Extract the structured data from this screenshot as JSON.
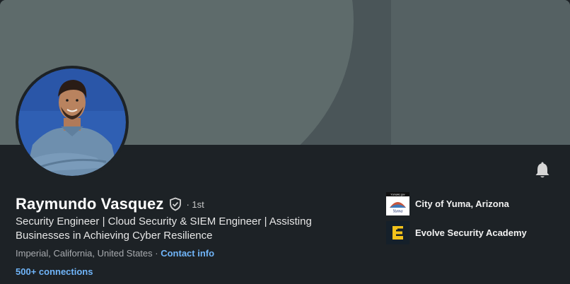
{
  "profile": {
    "name": "Raymundo Vasquez",
    "degree": "· 1st",
    "headline": "Security Engineer | Cloud Security & SIEM Engineer | Assisting Businesses in Achieving Cyber Resilience",
    "location": "Imperial, California, United States",
    "location_separator": " · ",
    "contact_label": "Contact info",
    "connections": "500+ connections"
  },
  "organizations": [
    {
      "name": "City of Yuma, Arizona",
      "logo_icon": "city-of-yuma-logo",
      "logo_caption": "YumaAz.gov",
      "logo_script": "Yuma"
    },
    {
      "name": "Evolve Security Academy",
      "logo_icon": "evolve-security-logo"
    }
  ],
  "icons": {
    "verified": "shield-check-icon",
    "notifications": "bell-icon"
  },
  "colors": {
    "background": "#1d2226",
    "link": "#70b5f9",
    "banner": "#4a5558"
  }
}
